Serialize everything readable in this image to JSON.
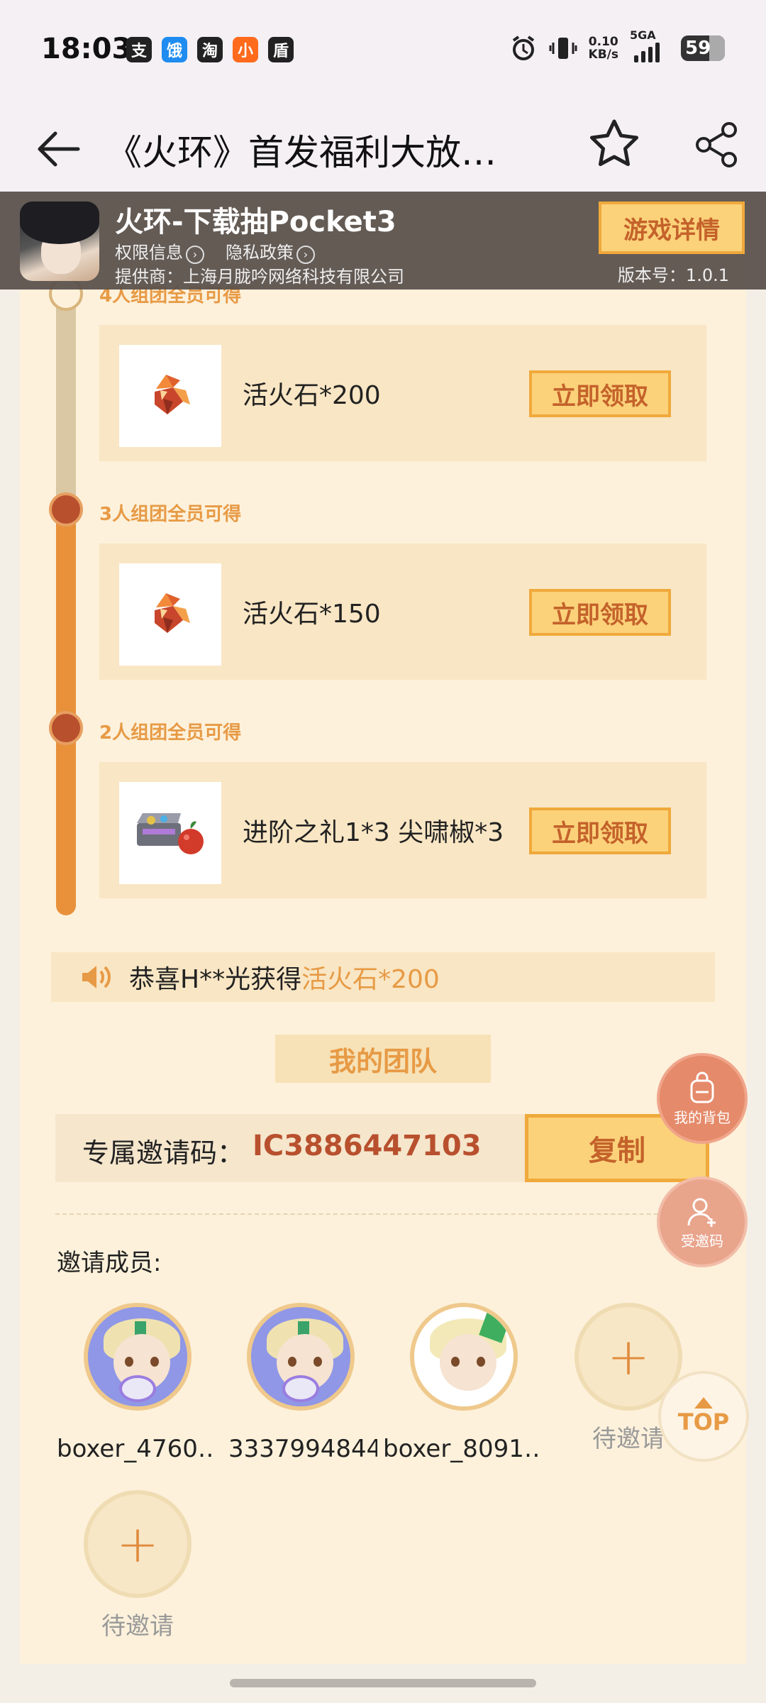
{
  "status_bar": {
    "time": "18:03",
    "app_icons": [
      "支",
      "饿",
      "淘",
      "小",
      "盾"
    ],
    "net_speed_value": "0.10",
    "net_speed_unit": "KB/s",
    "network": "5GA",
    "battery": "59"
  },
  "nav": {
    "title": "《火环》首发福利大放…"
  },
  "game": {
    "name": "火环-下载抽Pocket3",
    "permission_link": "权限信息",
    "privacy_link": "隐私政策",
    "provider": "提供商：上海月胧吟网络科技有限公司",
    "detail_button": "游戏详情",
    "version": "版本号：1.0.1"
  },
  "rewards": [
    {
      "tier": "4人组团全员可得",
      "item": "活火石*200",
      "button": "立即领取",
      "claimed": false
    },
    {
      "tier": "3人组团全员可得",
      "item": "活火石*150",
      "button": "立即领取",
      "claimed": true
    },
    {
      "tier": "2人组团全员可得",
      "item": "进阶之礼1*3  尖啸椒*3",
      "button": "立即领取",
      "claimed": true
    }
  ],
  "broadcast": {
    "prefix": "恭喜H**光获得",
    "highlight": "活火石*200"
  },
  "team": {
    "title": "我的团队",
    "invite_label": "专属邀请码：",
    "invite_code": "IC3886447103",
    "copy_button": "复制",
    "members_label": "邀请成员:",
    "members": [
      {
        "name": "boxer_4760…"
      },
      {
        "name": "3337994844"
      },
      {
        "name": "boxer_8091…"
      },
      {
        "name": "待邀请"
      },
      {
        "name": "待邀请"
      }
    ],
    "pending_plus": "+"
  },
  "floating": {
    "bag": "我的背包",
    "invited": "受邀码",
    "top": "TOP"
  },
  "colors": {
    "accent": "#e79a45",
    "button_fill": "#fbd27a",
    "code_red": "#b8502e",
    "panel": "#fdf1db"
  }
}
